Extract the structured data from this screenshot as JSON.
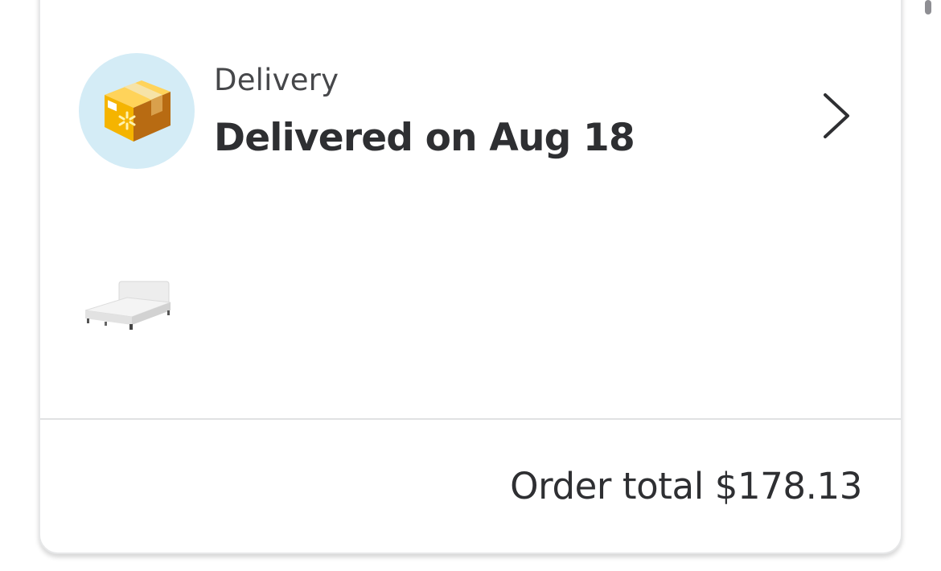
{
  "delivery": {
    "fulfillment_label": "Delivery",
    "status": "Delivered on Aug 18",
    "icon": "delivery-box-icon",
    "icon_bg_color": "#d4ecf6",
    "box_color": "#f5b400",
    "spark_color": "#ffc220"
  },
  "items": [
    {
      "name": "bed-thumbnail",
      "icon": "bed-icon"
    }
  ],
  "footer": {
    "order_total_text": "Order total $178.13"
  }
}
